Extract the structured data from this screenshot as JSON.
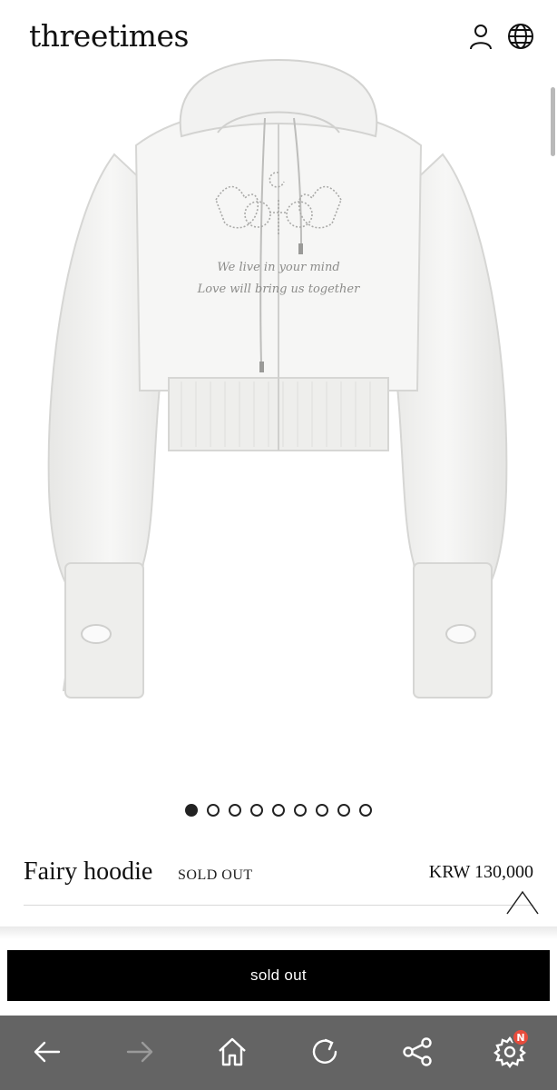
{
  "header": {
    "brand": "threetimes",
    "icons": [
      "user-icon",
      "globe-icon"
    ]
  },
  "product": {
    "image_text_line1": "We live in your mind",
    "image_text_line2": "Love will bring us together",
    "name": "Fairy hoodie",
    "status_badge": "SOLD OUT",
    "price": "KRW 130,000"
  },
  "carousel": {
    "total": 9,
    "active_index": 0
  },
  "actions": {
    "button_label": "sold out"
  },
  "browser_nav": {
    "items": [
      "back-icon",
      "forward-icon",
      "home-icon",
      "refresh-icon",
      "share-icon",
      "settings-icon"
    ],
    "settings_badge": "N"
  },
  "colors": {
    "nav_bar": "#646464",
    "button": "#000000",
    "badge": "#e74c3c"
  }
}
